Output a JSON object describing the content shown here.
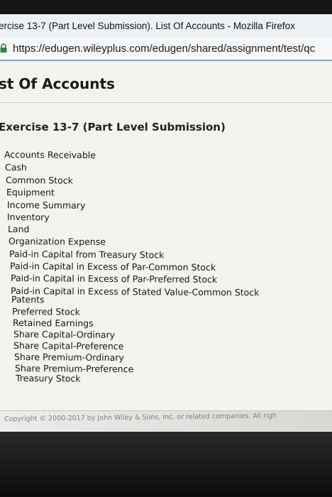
{
  "window": {
    "title": "ercise 13-7 (Part Level Submission). List Of Accounts - Mozilla Firefox"
  },
  "address_bar": {
    "url": "https://edugen.wileyplus.com/edugen/shared/assignment/test/qc",
    "icon": "lock-icon"
  },
  "page": {
    "title": "st Of Accounts",
    "exercise_heading": "Exercise 13-7 (Part Level Submission)",
    "accounts": [
      "Accounts Receivable",
      "Cash",
      "Common Stock",
      "Equipment",
      "Income Summary",
      "Inventory",
      "Land",
      "Organization Expense",
      "Paid-in Capital from Treasury Stock",
      "Paid-in Capital in Excess of Par-Common Stock",
      "Paid-in Capital in Excess of Par-Preferred Stock",
      "Paid-in Capital in Excess of Stated Value-Common Stock",
      "Patents",
      "Preferred Stock",
      "Retained Earnings",
      "Share Capital-Ordinary",
      "Share Capital-Preference",
      "Share Premium-Ordinary",
      "Share Premium-Preference",
      "Treasury Stock"
    ],
    "copyright": "Copyright © 2000-2017 by John Wiley & Sons, Inc. or related companies. All righ"
  }
}
